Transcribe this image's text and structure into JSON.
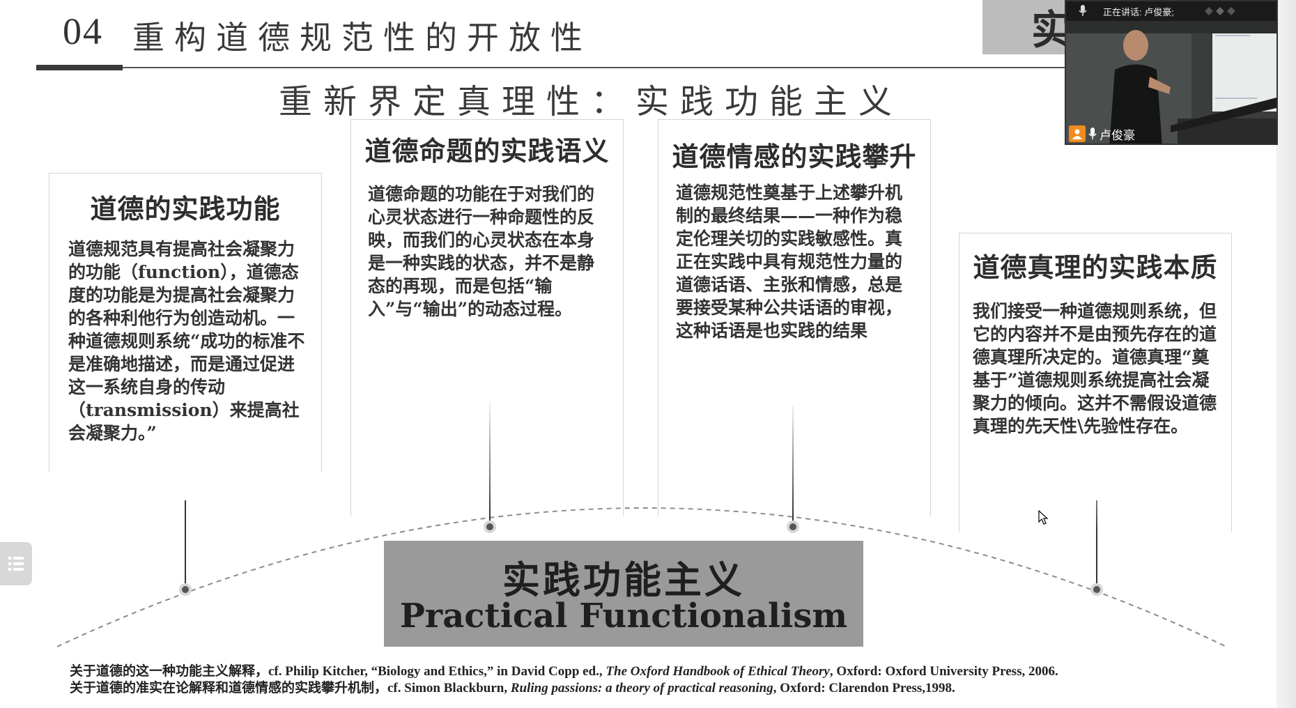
{
  "slide": {
    "number": "04",
    "section_title": "重构道德规范性的开放性",
    "subtitle": "重新界定真理性：实践功能主义",
    "corner_fragment": "实"
  },
  "cards": [
    {
      "title": "道德的实践功能",
      "text": "道德规范具有提高社会凝聚力的功能（function），道德态度的功能是为提高社会凝聚力的各种利他行为创造动机。一种道德规则系统“成功的标准不是准确地描述，而是通过促进这一系统自身的传动（transmission）来提高社会凝聚力。”"
    },
    {
      "title": "道德命题的实践语义",
      "text": "道德命题的功能在于对我们的心灵状态进行一种命题性的反映，而我们的心灵状态在本身是一种实践的状态，并不是静态的再现，而是包括“输入”与“输出”的动态过程。"
    },
    {
      "title": "道德情感的实践攀升",
      "text": "道德规范性奠基于上述攀升机制的最终结果——一种作为稳定伦理关切的实践敏感性。真正在实践中具有规范性力量的道德话语、主张和情感，总是要接受某种公共话语的审视，这种话语是也实践的结果"
    },
    {
      "title": "道德真理的实践本质",
      "text": "我们接受一种道德规则系统，但它的内容并不是由预先存在的道德真理所决定的。道德真理“奠基于”道德规则系统提高社会凝聚力的倾向。这并不需假设道德真理的先天性\\先验性存在。"
    }
  ],
  "center": {
    "title_cn": "实践功能主义",
    "title_en": "Practical Functionalism"
  },
  "footnotes": [
    {
      "prefix": "关于道德的这一种功能主义解释，cf. Philip Kitcher, “Biology and Ethics,” in David Copp ed., ",
      "italic": "The Oxford Handbook of Ethical Theory",
      "suffix": ",   Oxford: Oxford University Press, 2006."
    },
    {
      "prefix": "关于道德的准实在论解释和道德情感的实践攀升机制，cf. Simon Blackburn, ",
      "italic": "Ruling passions: a theory of practical reasoning",
      "suffix": ",   Oxford: Clarendon Press,1998."
    }
  ],
  "video": {
    "speaking_label": "正在讲话: 卢俊豪;",
    "participant_name": "卢俊豪"
  },
  "icons": {
    "menu": "list-menu-icon",
    "mic": "microphone-icon",
    "avatar": "user-avatar-icon",
    "cursor": "mouse-cursor-icon"
  },
  "colors": {
    "center_box": "#9a9a9a",
    "avatar_badge": "#f08c1f",
    "dots": "#555555"
  }
}
